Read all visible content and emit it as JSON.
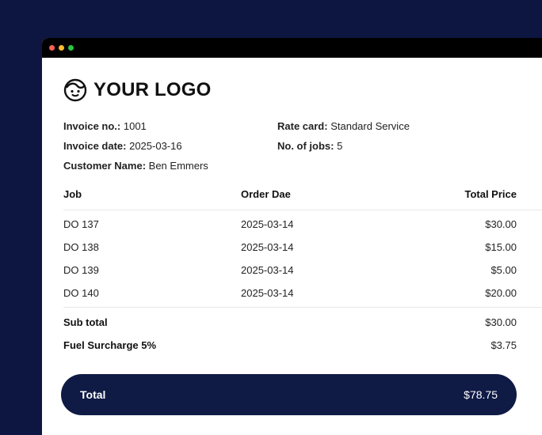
{
  "logo": {
    "text": "YOUR LOGO",
    "icon": "face-icon"
  },
  "invoice": {
    "invoice_no_label": "Invoice no.:",
    "invoice_no": "1001",
    "invoice_date_label": "Invoice date:",
    "invoice_date": "2025-03-16",
    "customer_label": "Customer Name:",
    "customer_name": "Ben Emmers",
    "rate_card_label": "Rate card:",
    "rate_card": "Standard Service",
    "jobs_label": "No. of jobs:",
    "jobs": "5"
  },
  "table": {
    "headers": {
      "job": "Job",
      "order_date": "Order Dae",
      "total_price": "Total Price"
    },
    "rows": [
      {
        "job": "DO 137",
        "order_date": "2025-03-14",
        "price": "$30.00"
      },
      {
        "job": "DO 138",
        "order_date": "2025-03-14",
        "price": "$15.00"
      },
      {
        "job": "DO 139",
        "order_date": "2025-03-14",
        "price": "$5.00"
      },
      {
        "job": "DO 140",
        "order_date": "2025-03-14",
        "price": "$20.00"
      }
    ]
  },
  "summary": {
    "subtotal_label": "Sub total",
    "subtotal": "$30.00",
    "surcharge_label": "Fuel Surcharge 5%",
    "surcharge": "$3.75",
    "total_label": "Total",
    "total": "$78.75"
  },
  "colors": {
    "background": "#0d1640",
    "total_bar": "#0f1a45",
    "titlebar": "#000000"
  }
}
